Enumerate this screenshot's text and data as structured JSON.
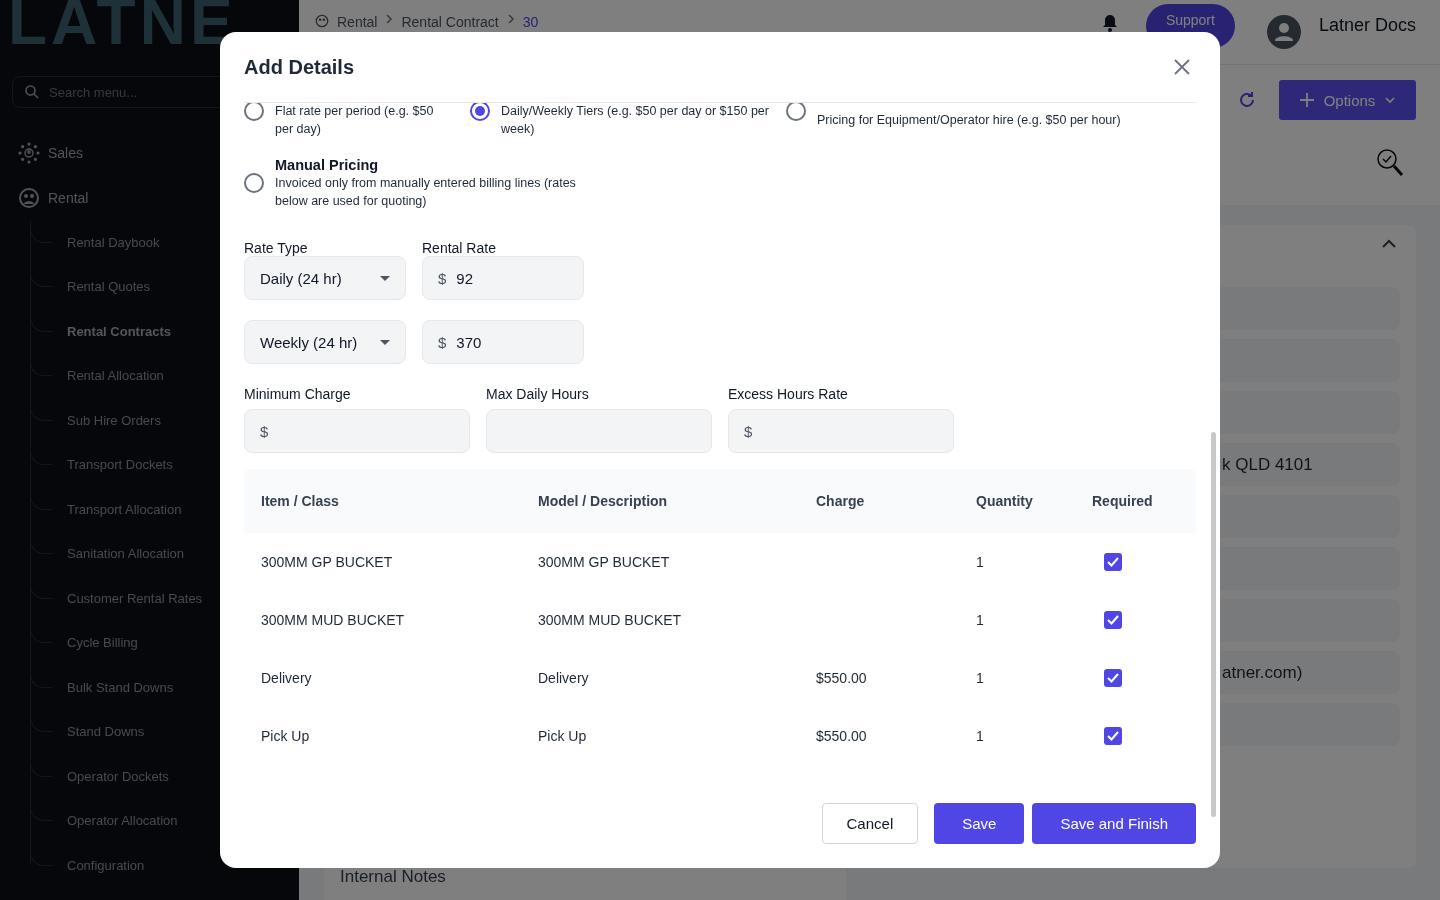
{
  "sidebar": {
    "logo": "LATNE",
    "search": {
      "placeholder": "Search menu..."
    },
    "items": [
      {
        "label": "Sales"
      },
      {
        "label": "Rental",
        "children": [
          {
            "label": "Rental Daybook",
            "selected": false
          },
          {
            "label": "Rental Quotes",
            "selected": false
          },
          {
            "label": "Rental Contracts",
            "selected": true
          },
          {
            "label": "Rental Allocation",
            "selected": false
          },
          {
            "label": "Sub Hire Orders",
            "selected": false
          },
          {
            "label": "Transport Dockets",
            "selected": false
          },
          {
            "label": "Transport Allocation",
            "selected": false
          },
          {
            "label": "Sanitation Allocation",
            "selected": false
          },
          {
            "label": "Customer Rental Rates",
            "selected": false
          },
          {
            "label": "Cycle Billing",
            "selected": false
          },
          {
            "label": "Bulk Stand Downs",
            "selected": false
          },
          {
            "label": "Stand Downs",
            "selected": false
          },
          {
            "label": "Operator Dockets",
            "selected": false
          },
          {
            "label": "Operator Allocation",
            "selected": false
          },
          {
            "label": "Configuration",
            "selected": false
          }
        ]
      }
    ]
  },
  "header": {
    "breadcrumb": [
      "Rental",
      "Rental Contract",
      "30"
    ],
    "support_button": "Support",
    "user": "Latner Docs"
  },
  "toolbar": {
    "options_button": "Options"
  },
  "record_card": {
    "fields": [
      {
        "kind": "empty"
      },
      {
        "kind": "empty"
      },
      {
        "kind": "empty"
      },
      {
        "kind": "text",
        "value": "k QLD 4101"
      },
      {
        "kind": "empty"
      },
      {
        "kind": "empty"
      },
      {
        "kind": "empty"
      },
      {
        "kind": "text",
        "value": "atner.com)"
      },
      {
        "kind": "empty"
      }
    ]
  },
  "notes_card": {
    "label": "Internal Notes"
  },
  "modal": {
    "title": "Add Details",
    "pricing_options": [
      {
        "description": "Flat rate per period (e.g. $50 per day)",
        "selected": false
      },
      {
        "description": "Daily/Weekly Tiers (e.g. $50 per day or $150 per week)",
        "selected": true
      },
      {
        "description": "Pricing for Equipment/Operator hire (e.g. $50 per hour)",
        "selected": false
      },
      {
        "title": "Manual Pricing",
        "description": "Invoiced only from manually entered billing lines (rates below are used for quoting)",
        "selected": false
      }
    ],
    "rate_labels": [
      "Rate Type",
      "Rental Rate"
    ],
    "rates": [
      {
        "type": "Daily (24 hr)",
        "prefix": "$",
        "rate": "92"
      },
      {
        "type": "Weekly (24 hr)",
        "prefix": "$",
        "rate": "370"
      }
    ],
    "extra_fields": [
      {
        "label": "Minimum Charge",
        "prefix": "$"
      },
      {
        "label": "Max Daily Hours"
      },
      {
        "label": "Excess Hours Rate",
        "prefix": "$"
      }
    ],
    "table": {
      "columns": [
        "Item / Class",
        "Model / Description",
        "Charge",
        "Quantity",
        "Required"
      ],
      "rows": [
        {
          "item": "300MM GP BUCKET",
          "model": "300MM GP BUCKET",
          "quantity": "1",
          "required": true
        },
        {
          "item": "300MM MUD BUCKET",
          "model": "300MM MUD BUCKET",
          "quantity": "1",
          "required": true
        },
        {
          "item": "Delivery",
          "model": "Delivery",
          "charge": "$550.00",
          "quantity": "1",
          "required": true
        },
        {
          "item": "Pick Up",
          "model": "Pick Up",
          "charge": "$550.00",
          "quantity": "1",
          "required": true
        }
      ]
    },
    "buttons": [
      {
        "label": "Cancel",
        "kind": "secondary"
      },
      {
        "label": "Save",
        "kind": "primary"
      },
      {
        "label": "Save and Finish",
        "kind": "primary"
      }
    ]
  }
}
